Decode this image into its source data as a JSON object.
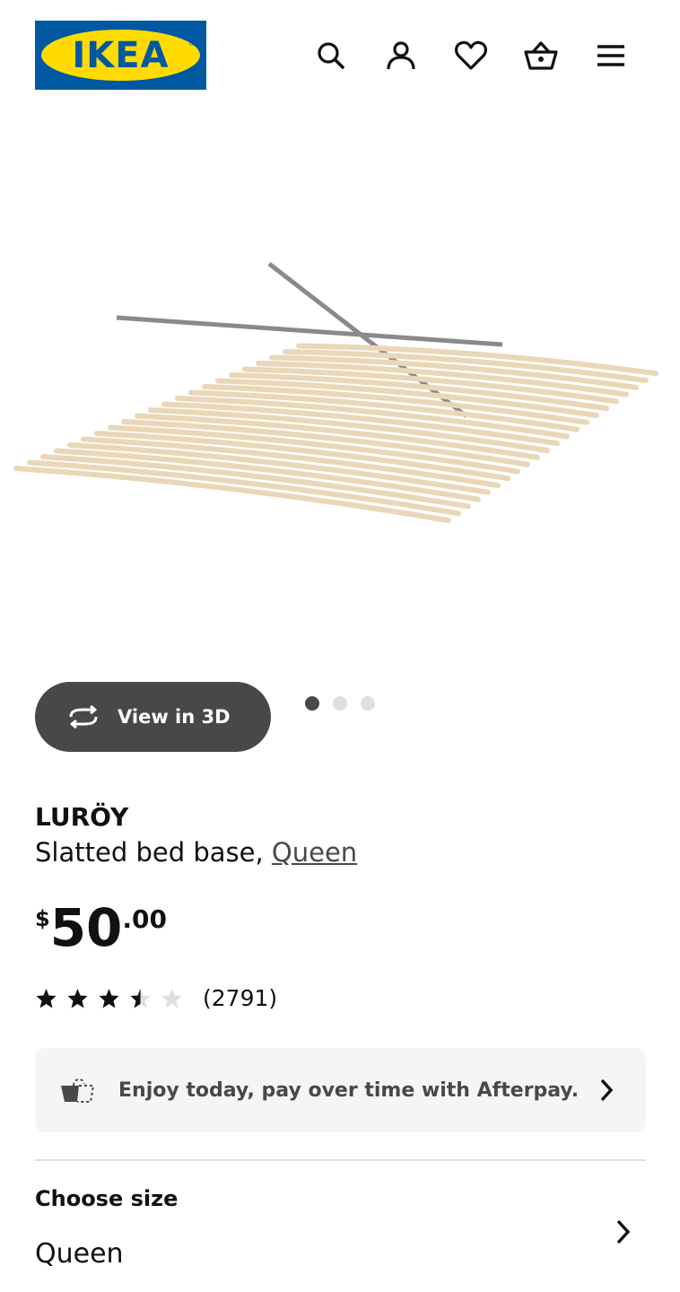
{
  "header": {
    "logo_text": "IKEA",
    "logo_reg": "®",
    "icons": [
      "search-icon",
      "account-icon",
      "heart-icon",
      "basket-icon",
      "menu-icon"
    ]
  },
  "gallery": {
    "view3d_label": "View in 3D",
    "dot_count": 3,
    "active_dot": 0
  },
  "product": {
    "name": "LURÖY",
    "description": "Slatted bed base,",
    "size_link": "Queen",
    "price_currency": "$",
    "price_integer": "50",
    "price_decimal": ".00",
    "rating_value": 3.5,
    "rating_max": 5,
    "review_count": "(2791)"
  },
  "afterpay": {
    "text": "Enjoy today, pay over time with Afterpay."
  },
  "size_selector": {
    "title": "Choose size",
    "value": "Queen"
  },
  "colors": {
    "brand_blue": "#0058a3",
    "brand_yellow": "#ffdb00",
    "dark_button": "#484848",
    "afterpay_bg": "#f5f5f5"
  }
}
